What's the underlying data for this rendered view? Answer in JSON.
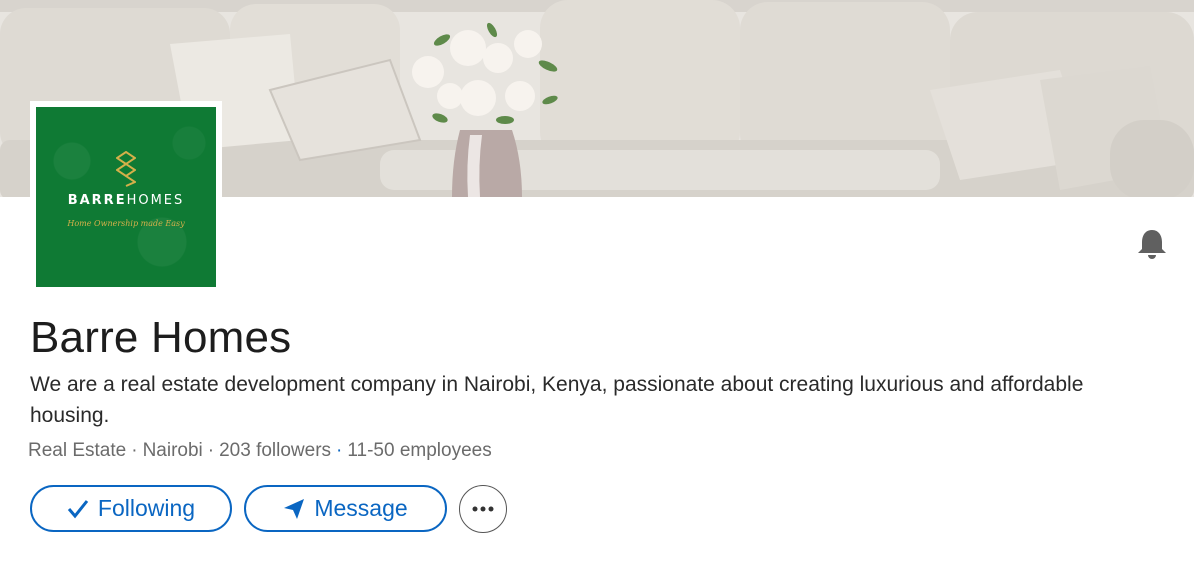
{
  "company": {
    "name": "Barre Homes",
    "description": "We are a real estate development company in Nairobi, Kenya, passionate about creating luxurious and affordable housing.",
    "industry": "Real Estate",
    "location": "Nairobi",
    "followers": "203 followers",
    "size": "11-50 employees",
    "separator": "·"
  },
  "logo": {
    "brand_bold": "BARRE",
    "brand_light": "HOMES",
    "tagline": "Home Ownership made Easy",
    "background_color": "#0f7a34",
    "accent_color": "#d4b04a"
  },
  "actions": {
    "following_label": "Following",
    "message_label": "Message",
    "more_icon": "ellipsis-icon",
    "following_icon": "checkmark-icon",
    "message_icon": "send-icon",
    "accent_color": "#0a66c2"
  },
  "banner": {
    "subject": "cover-photo-sofa-flowers"
  },
  "notifications": {
    "icon": "bell-icon"
  }
}
